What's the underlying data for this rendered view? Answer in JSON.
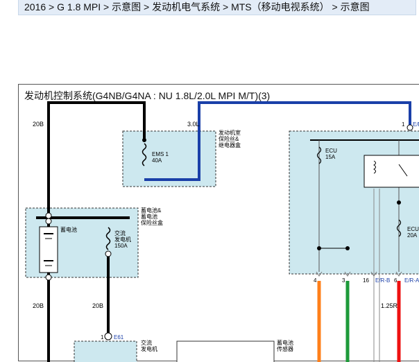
{
  "breadcrumb": {
    "items": [
      "2016",
      "G 1.8 MPI",
      "示意图",
      "发动机电气系统",
      "MTS（移动电视系统）",
      "示意图"
    ],
    "separator": " > "
  },
  "diagram": {
    "title": "发动机控制系统(G4NB/G4NA : NU 1.8L/2.0L MPI M/T)(3)",
    "labels": {
      "wire_20b_top": "20B",
      "wire_3_0l": "3.0L",
      "engine_room_box": [
        "发动机室",
        "保险丝&",
        "继电器盒"
      ],
      "ems1_fuse": [
        "EMS 1",
        "40A"
      ],
      "ecu_fuse_15a": [
        "ECU",
        "15A"
      ],
      "pin_1_er": "1",
      "er_label_top": "E/R",
      "battery_box": [
        "蓄电池&",
        "蓄电池",
        "保险丝盒"
      ],
      "battery": "蓄电池",
      "alternator_fuse": [
        "交流",
        "发电机",
        "150A"
      ],
      "ecu_fuse_20a": [
        "ECU",
        "20A"
      ],
      "pin_4": "4",
      "pin_3": "3",
      "pin_16": "16",
      "er_b": "E/R-B",
      "pin_6": "6",
      "er_a": "E/R-A",
      "wire_20b_left": "20B",
      "wire_20b_mid": "20B",
      "wire_1_25r": "1.25R",
      "pin_1_e61": "1",
      "e61": "E61",
      "alternator_box": [
        "交流",
        "发电机"
      ],
      "battery_sensor_box": [
        "蓄电池",
        "传感器"
      ]
    }
  },
  "colors": {
    "wire_blue": "#1a3fa8",
    "wire_black": "#000000",
    "wire_orange": "#ff7f1a",
    "wire_green": "#1e9a3a",
    "wire_red": "#ee1111",
    "box_fill": "#cde8ef",
    "connector_blue": "#1a3fa8"
  }
}
